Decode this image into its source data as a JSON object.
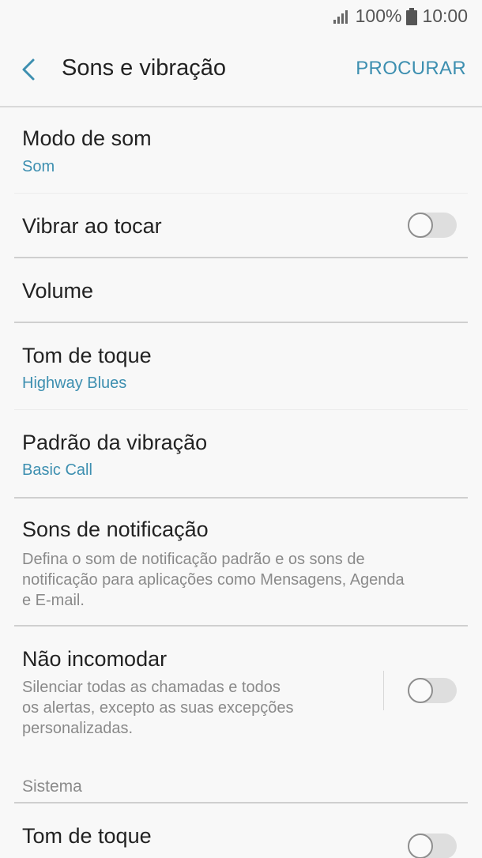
{
  "status_bar": {
    "battery": "100%",
    "time": "10:00",
    "signal_icon": "signal-icon",
    "battery_icon": "battery-icon"
  },
  "app_bar": {
    "back_icon": "chevron-left-icon",
    "title": "Sons e vibração",
    "search_label": "PROCURAR"
  },
  "settings": {
    "sound_mode": {
      "title": "Modo de som",
      "value": "Som"
    },
    "vibrate_on_ring": {
      "title": "Vibrar ao tocar",
      "enabled": false
    },
    "volume": {
      "title": "Volume"
    },
    "ringtone": {
      "title": "Tom de toque",
      "value": "Highway Blues"
    },
    "vibration_pattern": {
      "title": "Padrão da vibração",
      "value": "Basic Call"
    },
    "notification_sounds": {
      "title": "Sons de notificação",
      "desc_line1": "Defina o som de notificação padrão e os sons de",
      "desc_line2": "notificação para aplicações como Mensagens, Agenda",
      "desc_line3": "e E-mail."
    },
    "do_not_disturb": {
      "title": "Não incomodar",
      "desc_line1": "Silenciar todas as chamadas e todos",
      "desc_line2": "os alertas, excepto as suas excepções",
      "desc_line3": "personalizadas.",
      "enabled": false
    }
  },
  "system_section": {
    "header": "Sistema",
    "ringtone_system": {
      "title": "Tom de toque",
      "enabled": false
    }
  },
  "colors": {
    "accent": "#3d8fb0",
    "background": "#f8f8f8",
    "text_primary": "#222222",
    "text_secondary": "#8a8a8a"
  }
}
